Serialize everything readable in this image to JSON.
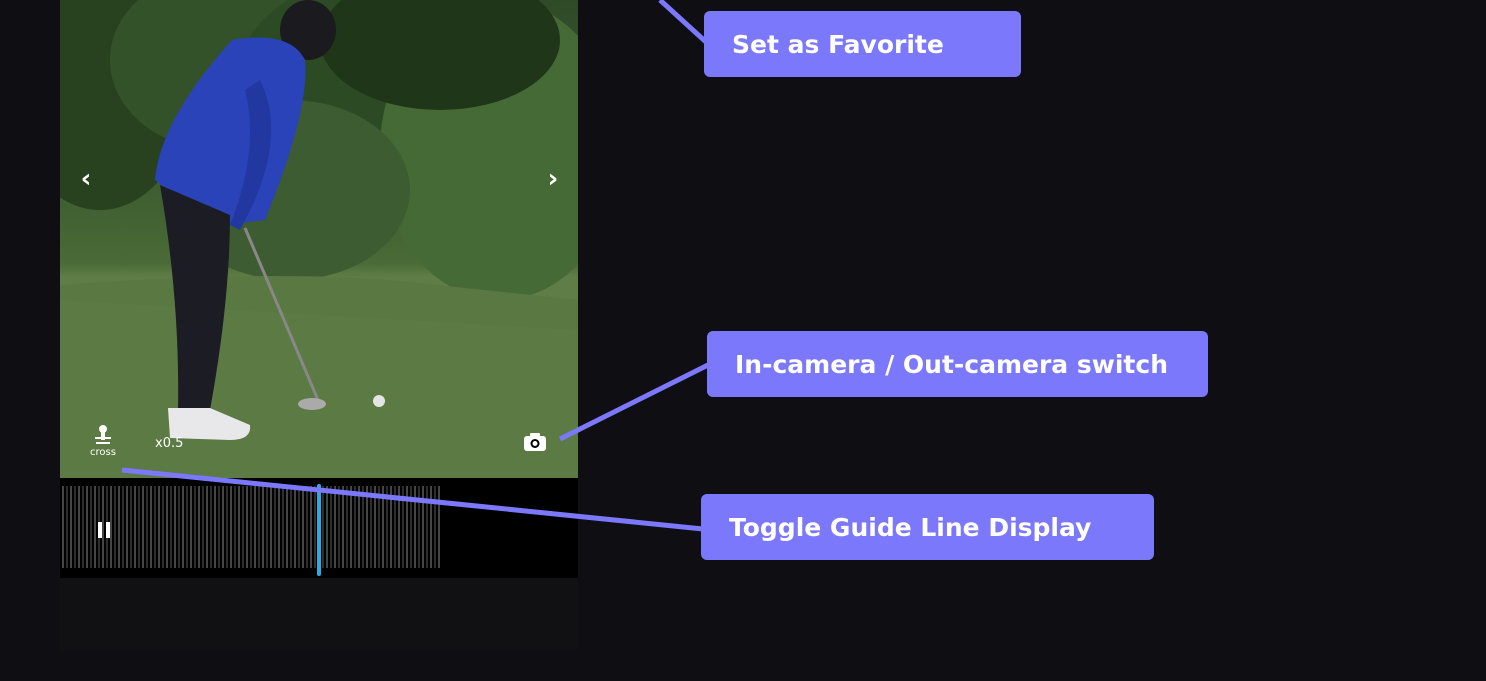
{
  "player": {
    "speed": "x0.5",
    "guide_toggle_label": "cross",
    "playback_state": "playing",
    "icons": {
      "prev": "chevron-left-icon",
      "next": "chevron-right-icon",
      "guide": "golfer-guide-icon",
      "camera": "camera-switch-icon",
      "pause": "pause-icon"
    }
  },
  "callouts": {
    "favorite": "Set as Favorite",
    "camera_switch": "In-camera / Out-camera switch",
    "guide_line": "Toggle Guide Line Display"
  },
  "colors": {
    "background": "#0f0f13",
    "callout": "#7b78fb",
    "playhead": "#2fa9e0"
  }
}
